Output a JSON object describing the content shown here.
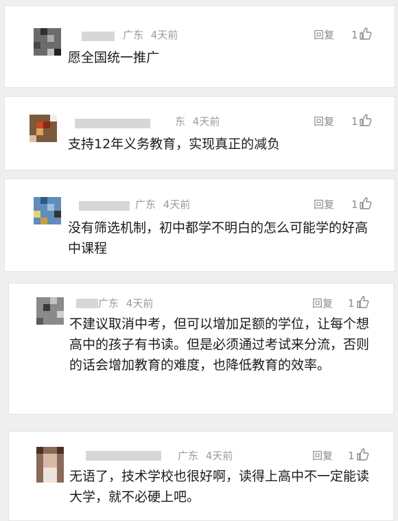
{
  "comments": [
    {
      "location": "广东",
      "time": "4天前",
      "reply": "回复",
      "likes": "1",
      "text": "愿全国统一推广"
    },
    {
      "location": "东",
      "time": "4天前",
      "reply": "回复",
      "likes": "1",
      "text": "支持12年义务教育，实现真正的减负"
    },
    {
      "location": "广东",
      "time": "4天前",
      "reply": "回复",
      "likes": "1",
      "text": "没有筛选机制，初中都学不明白的怎么可能学的好高中课程"
    },
    {
      "location": "广东",
      "time": "4天前",
      "reply": "回复",
      "likes": "1",
      "text": "不建议取消中考，但可以增加足额的学位，让每个想高中的孩子有书读。但是必须通过考试来分流，否则的话会增加教育的难度，也降低教育的效率。"
    },
    {
      "location": "广东",
      "time": "4天前",
      "reply": "回复",
      "likes": "1",
      "text": "无语了，技术学校也很好啊，读得上高中不一定能读大学，就不必硬上吧。"
    }
  ],
  "icons": {
    "like": "thumbs-up-icon"
  },
  "colors": {
    "meta": "#9a9a9a",
    "text": "#1a1a1a",
    "card": "#ffffff",
    "page": "#efefef"
  }
}
